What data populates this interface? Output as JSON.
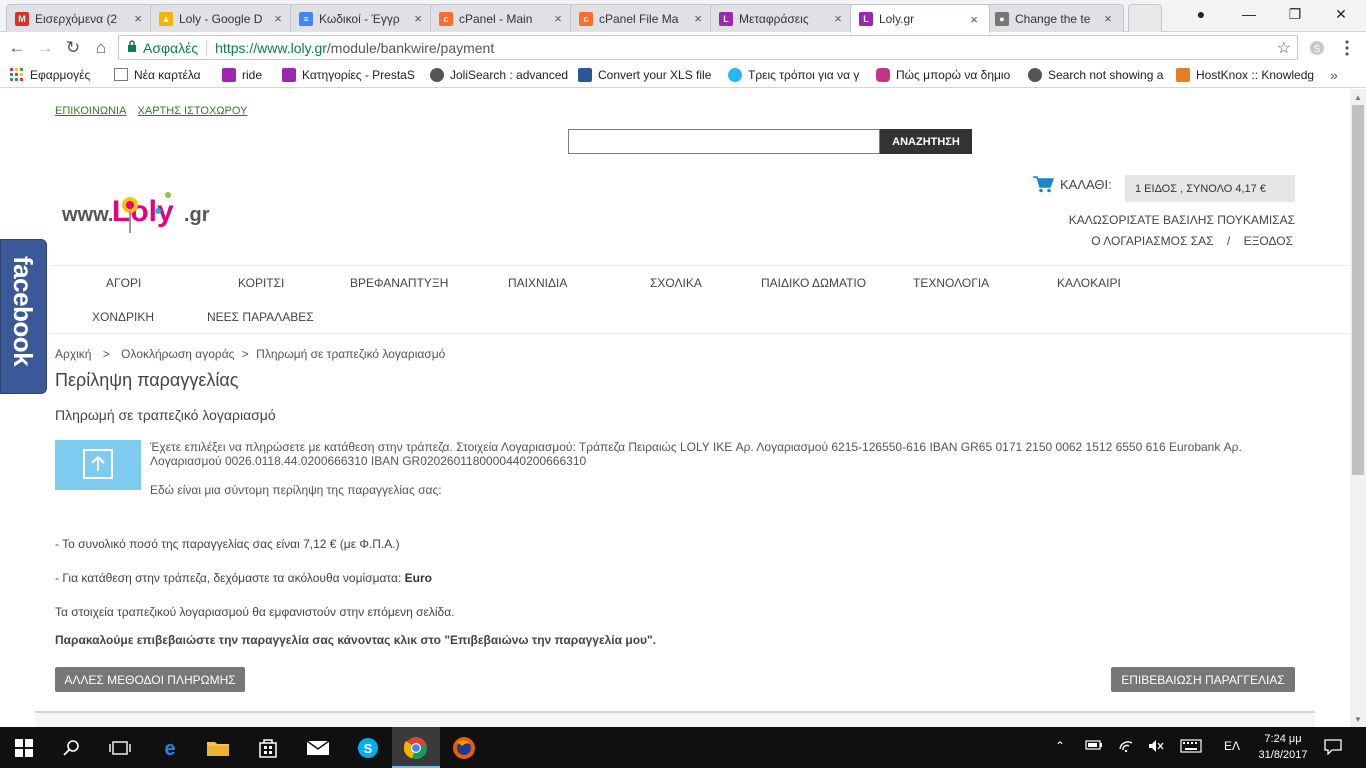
{
  "browser": {
    "tabs": [
      {
        "title": "Εισερχόμενα (2",
        "favicon_color": "#d93025",
        "favicon_char": "M"
      },
      {
        "title": "Loly - Google D",
        "favicon_color": "#f4b400",
        "favicon_char": "▲"
      },
      {
        "title": "Κωδικοί - Έγγρ",
        "favicon_color": "#4285f4",
        "favicon_char": "≡"
      },
      {
        "title": "cPanel - Main",
        "favicon_color": "#ff6c2c",
        "favicon_char": "c"
      },
      {
        "title": "cPanel File Ma",
        "favicon_color": "#ff6c2c",
        "favicon_char": "c"
      },
      {
        "title": "Μεταφράσεις",
        "favicon_color": "#9c27b0",
        "favicon_char": "L"
      },
      {
        "title": "Loly.gr",
        "favicon_color": "#9c27b0",
        "favicon_char": "L"
      },
      {
        "title": "Change the te",
        "favicon_color": "#777777",
        "favicon_char": "●"
      }
    ],
    "close_glyph": "×",
    "window_controls": {
      "profile": "●",
      "minimize": "—",
      "maximize": "❐",
      "close": "✕"
    },
    "nav": {
      "back": "←",
      "forward": "→",
      "reload": "↻",
      "home": "⌂"
    },
    "omnibox": {
      "secure_label": "Ασφαλές",
      "url_scheme_host": "https://www.loly.gr",
      "url_path": "/module/bankwire/payment",
      "star": "☆"
    },
    "bookmarks": [
      {
        "label": "Εφαρμογές",
        "color": "#e53935"
      },
      {
        "label": "Νέα καρτέλα",
        "color": "#ffffff"
      },
      {
        "label": "ride",
        "color": "#9c27b0"
      },
      {
        "label": "Κατηγορίες - PrestaS",
        "color": "#9c27b0"
      },
      {
        "label": "JoliSearch : advanced",
        "color": "#555555"
      },
      {
        "label": "Convert your XLS file",
        "color": "#2b5797"
      },
      {
        "label": "Τρεις τρόποι για να γ",
        "color": "#29b6f6"
      },
      {
        "label": "Πώς μπορώ να δημιο",
        "color": "#c13584"
      },
      {
        "label": "Search not showing a",
        "color": "#555555"
      },
      {
        "label": "HostKnox :: Knowledg",
        "color": "#e67e22"
      }
    ],
    "bookmarks_more": "»"
  },
  "site": {
    "top_links": [
      "ΕΠΙΚΟΙΝΩΝΙΑ",
      "ΧΑΡΤΗΣ ΙΣΤΟΧΩΡΟΥ"
    ],
    "search_button": "ΑΝΑΖΗΤΗΣΗ",
    "logo_text_prefix": "www.",
    "logo_text_brand": "Loly",
    "logo_text_suffix": ".gr",
    "cart_label": "ΚΑΛΑΘΙ:",
    "cart_summary": "1  ΕΙΔΟΣ , ΣΥΝΟΛΟ  4,17 €",
    "welcome": "ΚΑΛΩΣΟΡΙΣΑΤΕ ΒΑΣΙΛΗΣ ΠΟΥΚΑΜΙΣΑΣ",
    "account_link": "Ο ΛΟΓΑΡΙΑΣΜΟΣ ΣΑΣ",
    "account_sep": "/",
    "logout_link": "ΕΞΟΔΟΣ",
    "facebook_tab": "facebook",
    "menu": [
      "ΑΓΟΡΙ",
      "ΚΟΡΙΤΣΙ",
      "ΒΡΕΦΑΝΑΠΤΥΞΗ",
      "ΠΑΙΧΝΙΔΙΑ",
      "ΣΧΟΛΙΚΑ",
      "ΠΑΙΔΙΚΟ ΔΩΜΑΤΙΟ",
      "ΤΕΧΝΟΛΟΓΙΑ",
      "ΚΑΛΟΚΑΙΡΙ",
      "ΧΟΝΔΡΙΚΗ",
      "ΝΕΕΣ ΠΑΡΑΛΑΒΕΣ"
    ],
    "breadcrumb": [
      "Αρχική",
      "Ολοκλήρωση αγοράς",
      "Πληρωμή σε τραπεζικό λογαριασμό"
    ],
    "breadcrumb_sep": ">",
    "page_title": "Περίληψη παραγγελίας",
    "sub_title": "Πληρωμή σε τραπεζικό λογαριασμό",
    "bank_info": "Έχετε επιλέξει να πληρώσετε με κατάθεση στην τράπεζα. Στοιχεία Λογαριασμού: Τράπεζα Πειραιώς LOLY IKE Αρ. Λογαριασμού 6215-126550-616 IBAN GR65 0171 2150 0062 1512 6550 616 Eurobank Αρ. Λογαριασμού 0026.0118.44.0200666310 IBAN GR0202601180000440200666310",
    "bank_intro": "Εδώ είναι μια σύντομη περίληψη της παραγγελίας σας:",
    "total_line": "- Το συνολικό ποσό της παραγγελίας σας είναι 7,12 € (με Φ.Π.Α.)",
    "currency_line_prefix": "- Για κατάθεση στην τράπεζα, δεχόμαστε τα ακόλουθα νομίσματα:",
    "currency_value": "Euro",
    "details_line": "Τα στοιχεία τραπεζικού λογαριασμού θα εμφανιστούν στην επόμενη σελίδα.",
    "confirm_prompt": "Παρακαλούμε επιβεβαιώστε την παραγγελία σας κάνοντας κλικ στο \"Επιβεβαιώνω την παραγγελία μου\".",
    "other_methods_button": "ΑΛΛΕΣ ΜΕΘΟΔΟΙ ΠΛΗΡΩΜΗΣ",
    "confirm_button": "ΕΠΙΒΕΒΑΙΩΣΗ ΠΑΡΑΓΓΕΛΙΑΣ"
  },
  "taskbar": {
    "language": "ΕΛ",
    "time": "7:24 μμ",
    "date": "31/8/2017"
  }
}
